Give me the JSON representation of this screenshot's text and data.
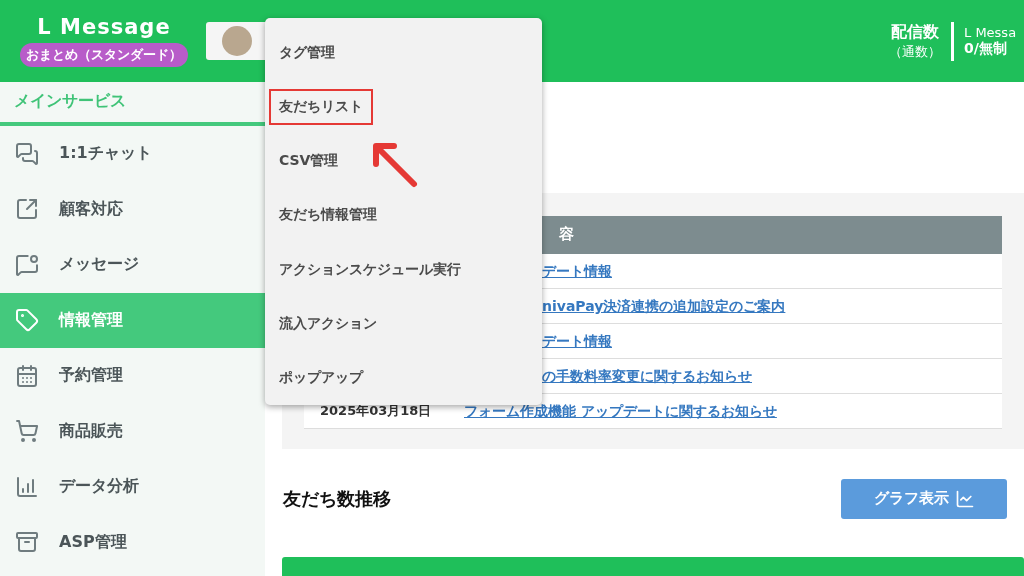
{
  "header": {
    "logo": "L Message",
    "plan_badge": "おまとめ（スタンダード）",
    "delivery_label": "配信数",
    "delivery_sub": "（通数）",
    "account_name": "L Messa",
    "account_count": "0/無制"
  },
  "sidebar": {
    "section_title": "メインサービス",
    "items": [
      {
        "label": "1:1チャット",
        "selected": false
      },
      {
        "label": "顧客対応",
        "selected": false
      },
      {
        "label": "メッセージ",
        "selected": false
      },
      {
        "label": "情報管理",
        "selected": true
      },
      {
        "label": "予約管理",
        "selected": false
      },
      {
        "label": "商品販売",
        "selected": false
      },
      {
        "label": "データ分析",
        "selected": false
      },
      {
        "label": "ASP管理",
        "selected": false
      }
    ]
  },
  "dropdown_menu": {
    "items": [
      {
        "label": "タグ管理",
        "highlighted": false
      },
      {
        "label": "友だちリスト",
        "highlighted": true
      },
      {
        "label": "CSV管理",
        "highlighted": false
      },
      {
        "label": "友だち情報管理",
        "highlighted": false
      },
      {
        "label": "アクションスケジュール実行",
        "highlighted": false
      },
      {
        "label": "流入アクション",
        "highlighted": false
      },
      {
        "label": "ポップアップ",
        "highlighted": false
      }
    ]
  },
  "news_table": {
    "header": "容",
    "rows": [
      {
        "link": "デート情報"
      },
      {
        "link": "nivaPay決済連携の追加設定のご案内"
      },
      {
        "link": "デート情報"
      },
      {
        "link": "の手数料率変更に関するお知らせ"
      },
      {
        "date": "2025年03月18日",
        "link": "フォーム作成機能 アップデートに関するお知らせ"
      }
    ]
  },
  "friends_trend": {
    "title": "友だち数推移",
    "graph_button": "グラフ表示"
  }
}
